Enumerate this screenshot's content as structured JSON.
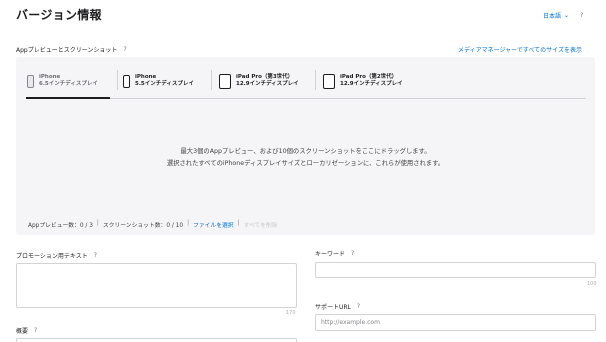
{
  "page": {
    "title": "バージョン情報",
    "language": "日本語",
    "help": "?"
  },
  "media": {
    "section_label": "Appプレビューとスクリーンショット",
    "manager_link": "メディアマネージャーですべてのサイズを表示",
    "tabs": [
      {
        "name": "iPhone",
        "size": "6.5インチディスプレイ",
        "active": true
      },
      {
        "name": "iPhone",
        "size": "5.5インチディスプレイ",
        "active": false
      },
      {
        "name": "iPad Pro（第3世代）",
        "size": "12.9インチディスプレイ",
        "active": false
      },
      {
        "name": "iPad Pro（第2世代）",
        "size": "12.9インチディスプレイ",
        "active": false
      }
    ],
    "drop_line1": "最大3個のAppプレビュー、および10個のスクリーンショットをここにドラッグします。",
    "drop_line2": "選択されたすべてのiPhoneディスプレイサイズとローカリゼーションに、これらが使用されます。",
    "preview_count": "Appプレビュー数：0 / 3",
    "screenshot_count": "スクリーンショット数：0 / 10",
    "separator": "|",
    "select_file": "ファイルを選択",
    "delete_all": "すべてを削除"
  },
  "fields": {
    "promo_label": "プロモーション用テキスト",
    "promo_count": "170",
    "keyword_label": "キーワード",
    "keyword_count": "100",
    "support_label": "サポートURL",
    "support_placeholder": "http://example.com",
    "overview_label": "概要"
  }
}
